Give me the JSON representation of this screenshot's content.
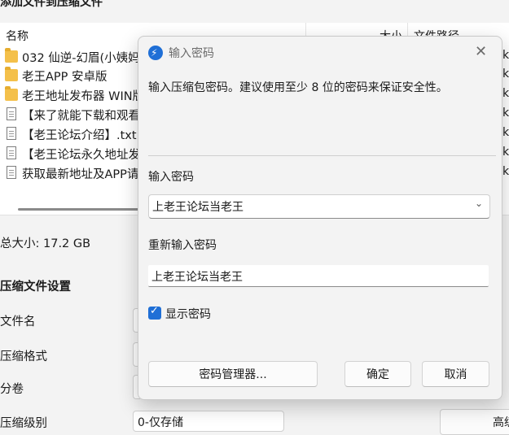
{
  "background_window": {
    "title": "添加文件到压缩文件",
    "columns": {
      "name": "名称",
      "size": "大小",
      "path": "文件路径"
    },
    "files": [
      {
        "icon": "folder-icon",
        "name": "032 仙逆-幻眉(小姨妈",
        "tail": "k"
      },
      {
        "icon": "folder-icon",
        "name": "老王APP 安卓版",
        "tail": "k"
      },
      {
        "icon": "folder-icon",
        "name": "老王地址发布器 WIN版",
        "tail": "k"
      },
      {
        "icon": "document-icon",
        "name": "【来了就能下载和观看",
        "tail": "k"
      },
      {
        "icon": "document-icon",
        "name": "【老王论坛介绍】.txt",
        "tail": "k"
      },
      {
        "icon": "document-icon",
        "name": "【老王论坛永久地址发",
        "tail": "k"
      },
      {
        "icon": "document-icon",
        "name": "获取最新地址及APP请",
        "tail": "k"
      }
    ],
    "total_size": "总大小: 17.2 GB",
    "settings_heading": "压缩文件设置",
    "settings": {
      "file_name": "文件名",
      "format": "压缩格式",
      "split": "分卷",
      "level": "压缩级别",
      "level_value": "0-仅存储",
      "advanced_partial": "高级"
    }
  },
  "dialog": {
    "title": "输入密码",
    "description": "输入压缩包密码。建议使用至少 8 位的密码来保证安全性。",
    "password_label": "输入密码",
    "password_value": "上老王论坛当老王",
    "confirm_label": "重新输入密码",
    "confirm_value": "上老王论坛当老王",
    "show_password_label": "显示密码",
    "show_password_checked": true,
    "buttons": {
      "manager": "密码管理器...",
      "ok": "确定",
      "cancel": "取消"
    },
    "accent_color": "#1f6fd6"
  }
}
